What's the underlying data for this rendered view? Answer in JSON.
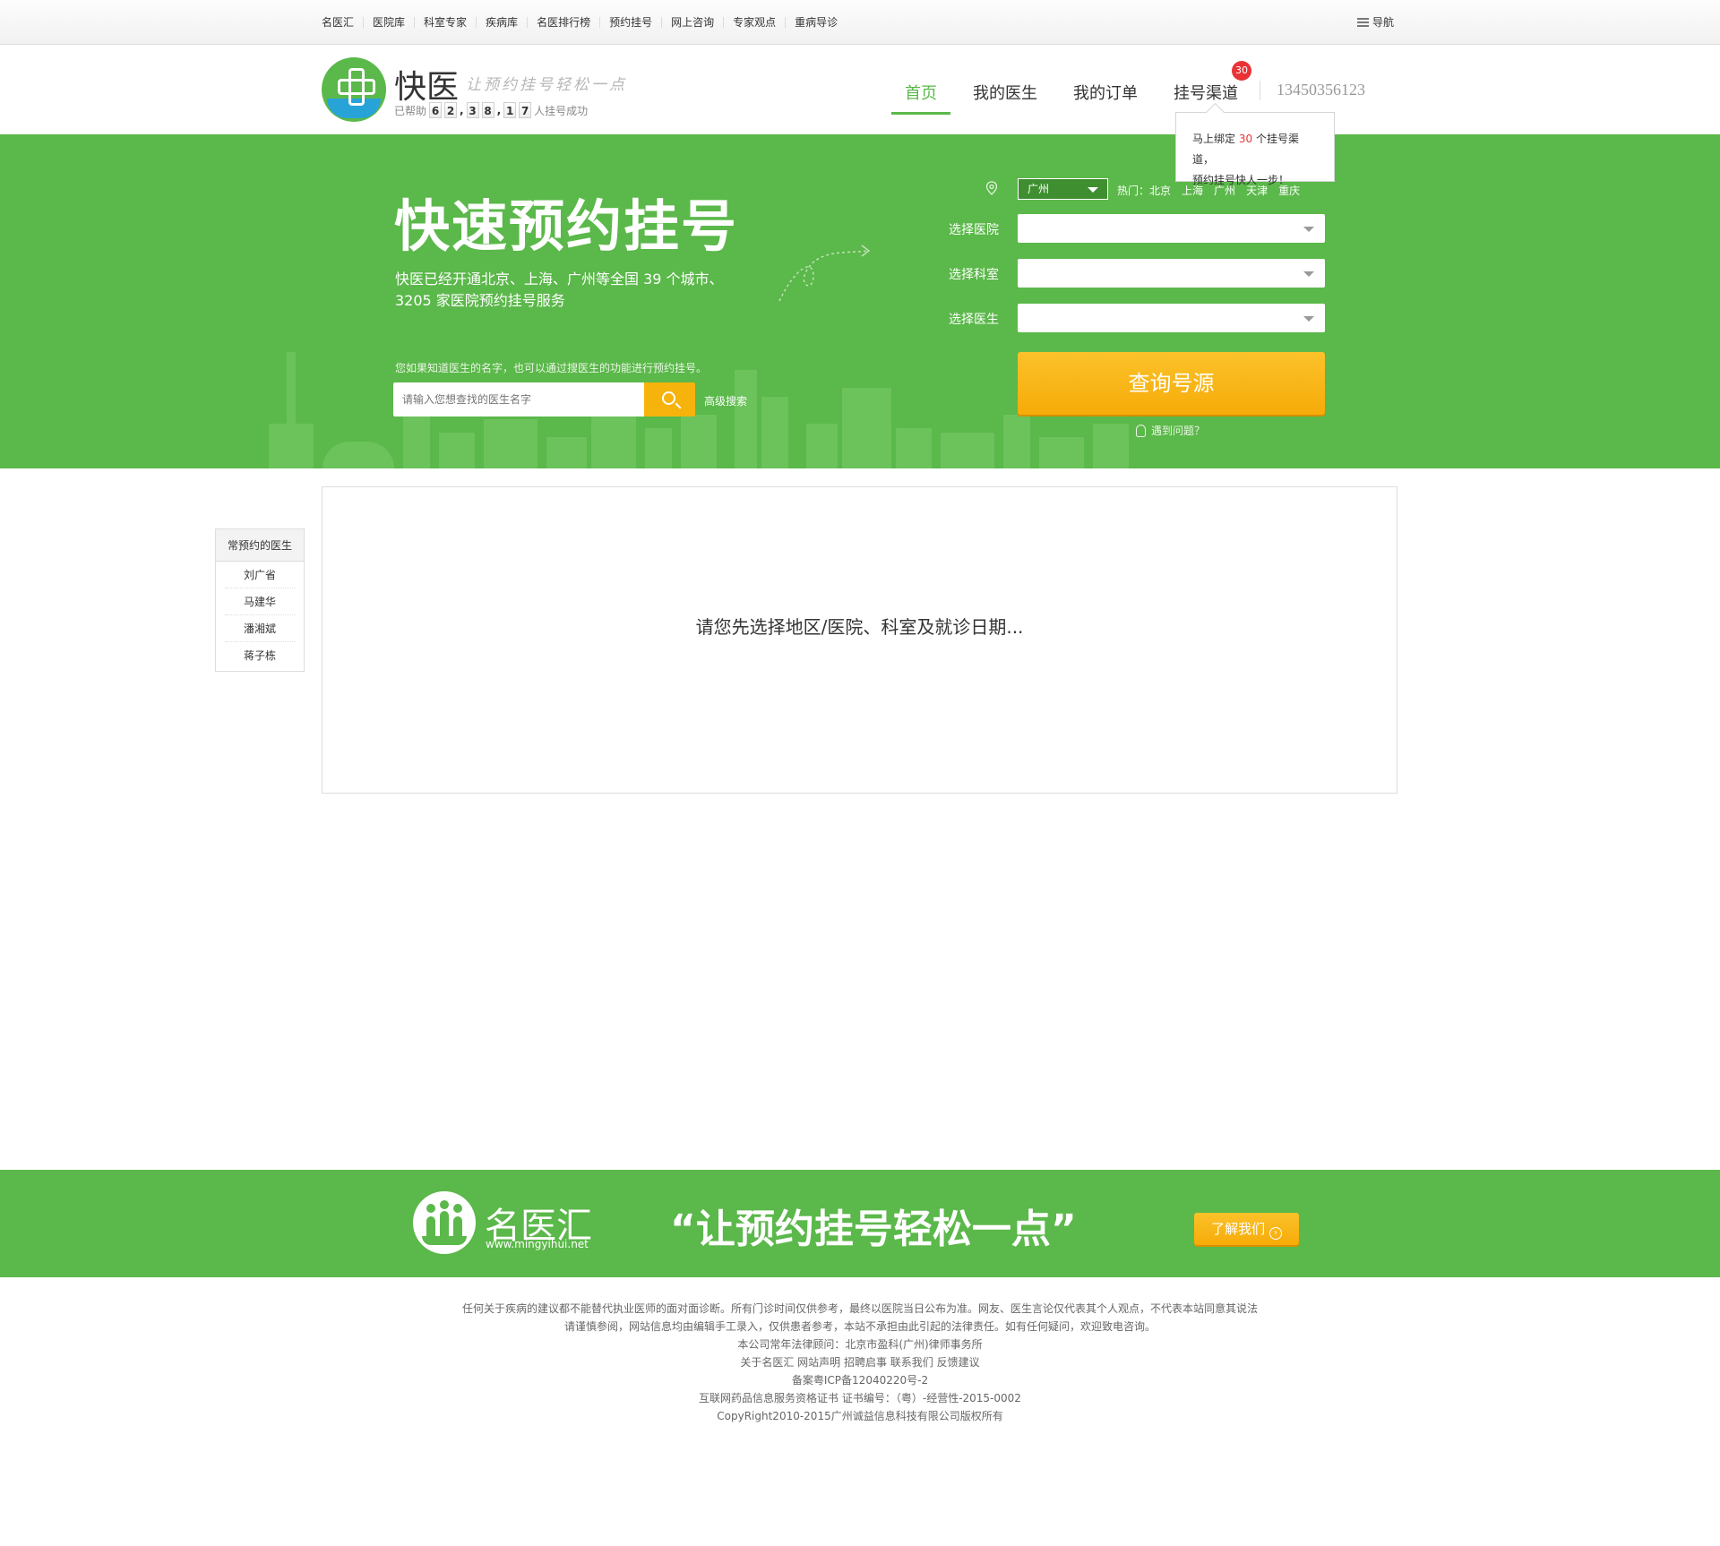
{
  "topbar": {
    "links": [
      "名医汇",
      "医院库",
      "科室专家",
      "疾病库",
      "名医排行榜",
      "预约挂号",
      "网上咨询",
      "专家观点",
      "重病导诊"
    ],
    "menu_label": "导航"
  },
  "header": {
    "logo_name": "快医",
    "slogan": "让预约挂号轻松一点",
    "helped_prefix": "已帮助",
    "helped_digits": [
      "6",
      "2",
      "3",
      "8",
      "1",
      "7"
    ],
    "helped_suffix": "人挂号成功",
    "nav": [
      "首页",
      "我的医生",
      "我的订单",
      "挂号渠道"
    ],
    "badge": "30",
    "phone": "13450356123",
    "tooltip": {
      "pre": "马上绑定",
      "num": "30",
      "post": "个挂号渠道，",
      "line2": "预约挂号快人一步！"
    }
  },
  "hero": {
    "title": "快速预约挂号",
    "desc_line1": "快医已经开通北京、上海、广州等全国 39 个城市、",
    "desc_line2": "3205 家医院预约挂号服务",
    "tip": "您如果知道医生的名字，也可以通过搜医生的功能进行预约挂号。",
    "search_placeholder": "请输入您想查找的医生名字",
    "advanced": "高级搜索",
    "city": "广州",
    "hot_label": "热门：",
    "hot_cities": [
      "北京",
      "上海",
      "广州",
      "天津",
      "重庆"
    ],
    "labels": [
      "选择医院",
      "选择科室",
      "选择医生"
    ],
    "query_button": "查询号源",
    "help": "遇到问题？"
  },
  "sidebar": {
    "title": "常预约的医生",
    "doctors": [
      "刘广省",
      "马建华",
      "潘湘斌",
      "蒋子栋"
    ]
  },
  "panel": {
    "message": "请您先选择地区/医院、科室及就诊日期..."
  },
  "footer": {
    "brand": "名医汇",
    "url": "www.mingyihui.net",
    "slogan": "“让预约挂号轻松一点”",
    "know_button": "了解我们",
    "legal": [
      "任何关于疾病的建议都不能替代执业医师的面对面诊断。所有门诊时间仅供参考，最终以医院当日公布为准。网友、医生言论仅代表其个人观点，不代表本站同意其说法",
      "请谨慎参阅，网站信息均由编辑手工录入，仅供患者参考，本站不承担由此引起的法律责任。如有任何疑问，欢迎致电咨询。",
      "本公司常年法律顾问：北京市盈科(广州)律师事务所",
      "关于名医汇 网站声明 招聘启事 联系我们 反馈建议",
      "备案粤ICP备12040220号-2",
      "互联网药品信息服务资格证书    证书编号：（粤）-经营性-2015-0002",
      "CopyRight2010-2015广州诚益信息科技有限公司版权所有"
    ]
  }
}
